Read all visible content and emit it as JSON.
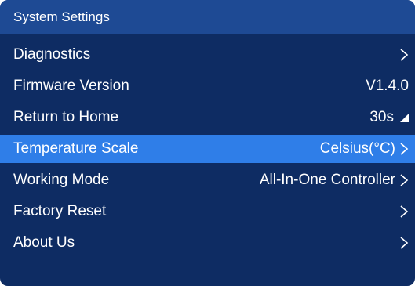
{
  "header": {
    "title": "System Settings"
  },
  "menu": {
    "items": [
      {
        "label": "Diagnostics",
        "value": "",
        "indicator": "chevron-right-icon"
      },
      {
        "label": "Firmware Version",
        "value": "V1.4.0",
        "indicator": ""
      },
      {
        "label": "Return to Home",
        "value": "30s",
        "indicator": "triangle-icon"
      },
      {
        "label": "Temperature Scale",
        "value": "Celsius(°C)",
        "indicator": "chevron-right-icon",
        "selected": true
      },
      {
        "label": "Working Mode",
        "value": "All-In-One Controller",
        "indicator": "chevron-right-icon"
      },
      {
        "label": "Factory Reset",
        "value": "",
        "indicator": "chevron-right-icon"
      },
      {
        "label": "About Us",
        "value": "",
        "indicator": "chevron-right-icon"
      }
    ]
  },
  "colors": {
    "background": "#0e2c63",
    "title_bar": "#1e4a94",
    "selected_row": "#2f7ee8",
    "text": "#ffffff"
  }
}
